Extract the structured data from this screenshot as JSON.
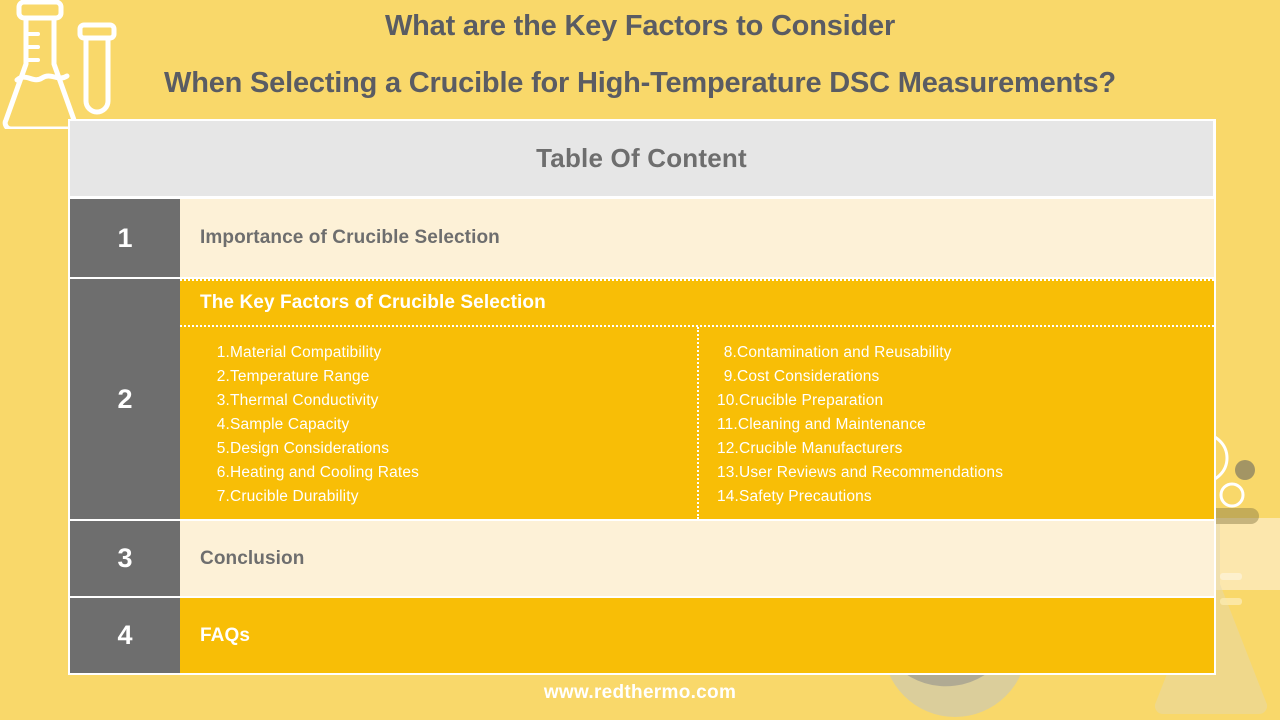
{
  "document": {
    "title_line1": "What are the Key Factors to Consider",
    "title_line2": "When Selecting a Crucible for High-Temperature DSC Measurements?",
    "title_color": "#5a5c63",
    "background_color": "#f9d86a"
  },
  "toc": {
    "header_label": "Table Of Content",
    "header_bg": "#e6e6e6",
    "number_cell_bg": "#6e6e6e",
    "cream_row_bg": "#fdf1d7",
    "gold_row_bg": "#f8be06",
    "rows": [
      {
        "number": "1",
        "label": "Importance of Crucible Selection",
        "style": "cream"
      },
      {
        "number": "2",
        "label": "The Key Factors of Crucible Selection",
        "style": "gold"
      },
      {
        "number": "3",
        "label": "Conclusion",
        "style": "cream"
      },
      {
        "number": "4",
        "label": "FAQs",
        "style": "gold"
      }
    ],
    "sub_items_left": [
      {
        "num": "1.",
        "text": "Material Compatibility"
      },
      {
        "num": "2.",
        "text": "Temperature Range"
      },
      {
        "num": "3.",
        "text": "Thermal Conductivity"
      },
      {
        "num": "4.",
        "text": "Sample Capacity"
      },
      {
        "num": "5.",
        "text": "Design Considerations"
      },
      {
        "num": "6.",
        "text": "Heating and Cooling Rates"
      },
      {
        "num": "7.",
        "text": "Crucible Durability"
      }
    ],
    "sub_items_right": [
      {
        "num": "8.",
        "text": "Contamination and Reusability"
      },
      {
        "num": "9.",
        "text": "Cost Considerations"
      },
      {
        "num": "10.",
        "text": "Crucible Preparation"
      },
      {
        "num": "11.",
        "text": "Cleaning and Maintenance"
      },
      {
        "num": "12.",
        "text": "Crucible Manufacturers"
      },
      {
        "num": "13.",
        "text": "User Reviews and Recommendations"
      },
      {
        "num": "14.",
        "text": "Safety Precautions"
      }
    ]
  },
  "footer": {
    "url": "www.redthermo.com"
  },
  "decorations": {
    "top_left": "erlenmeyer-flask-and-test-tube-outline",
    "bottom_right": "laboratory-glassware-test-tubes-round-flask-erlenmeyer-bubbles"
  }
}
